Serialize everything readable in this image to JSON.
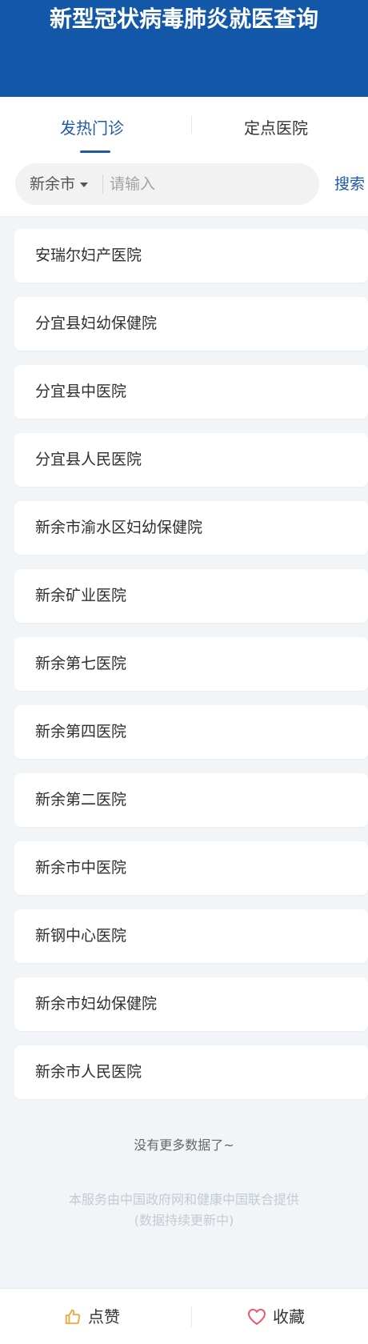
{
  "header": {
    "title": "新型冠状病毒肺炎就医查询"
  },
  "tabs": [
    {
      "label": "发热门诊",
      "active": true
    },
    {
      "label": "定点医院",
      "active": false
    }
  ],
  "search": {
    "city": "新余市",
    "placeholder": "请输入",
    "value": "",
    "button_label": "搜索"
  },
  "hospitals": [
    "安瑞尔妇产医院",
    "分宜县妇幼保健院",
    "分宜县中医院",
    "分宜县人民医院",
    "新余市渝水区妇幼保健院",
    "新余矿业医院",
    "新余第七医院",
    "新余第四医院",
    "新余第二医院",
    "新余市中医院",
    "新钢中心医院",
    "新余市妇幼保健院",
    "新余市人民医院"
  ],
  "no_more_text": "没有更多数据了~",
  "footer": {
    "line1": "本服务由中国政府网和健康中国联合提供",
    "line2": "(数据持续更新中)"
  },
  "bottom_bar": {
    "like_label": "点赞",
    "favorite_label": "收藏"
  },
  "colors": {
    "header_bg": "#1358a8",
    "accent": "#1f5aa8",
    "page_bg": "#f2f5f7",
    "like_icon": "#f0a53a",
    "favorite_icon": "#f0566a"
  },
  "icons": {
    "dropdown": "caret-down-icon",
    "like": "thumbs-up-icon",
    "favorite": "heart-icon"
  }
}
